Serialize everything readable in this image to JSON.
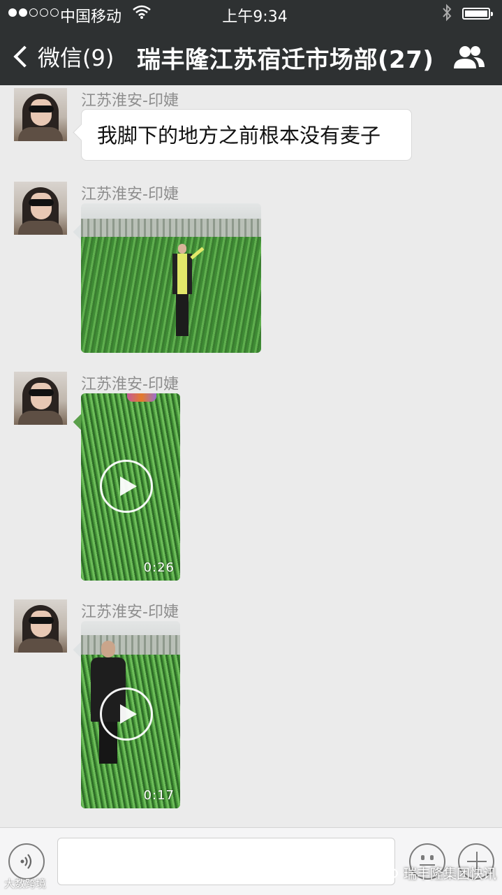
{
  "status_bar": {
    "carrier": "中国移动",
    "time": "上午9:34"
  },
  "nav": {
    "back_label": "微信(9)",
    "title": "瑞丰隆江苏宿迁市场部(27)"
  },
  "messages": [
    {
      "sender": "江苏淮安-印婕",
      "type": "text",
      "text": "我脚下的地方之前根本没有麦子"
    },
    {
      "sender": "江苏淮安-印婕",
      "type": "image"
    },
    {
      "sender": "江苏淮安-印婕",
      "type": "video",
      "duration": "0:26"
    },
    {
      "sender": "江苏淮安-印婕",
      "type": "video",
      "duration": "0:17"
    }
  ],
  "watermarks": {
    "left": "大数跨境",
    "right": "瑞丰隆集团快讯"
  }
}
